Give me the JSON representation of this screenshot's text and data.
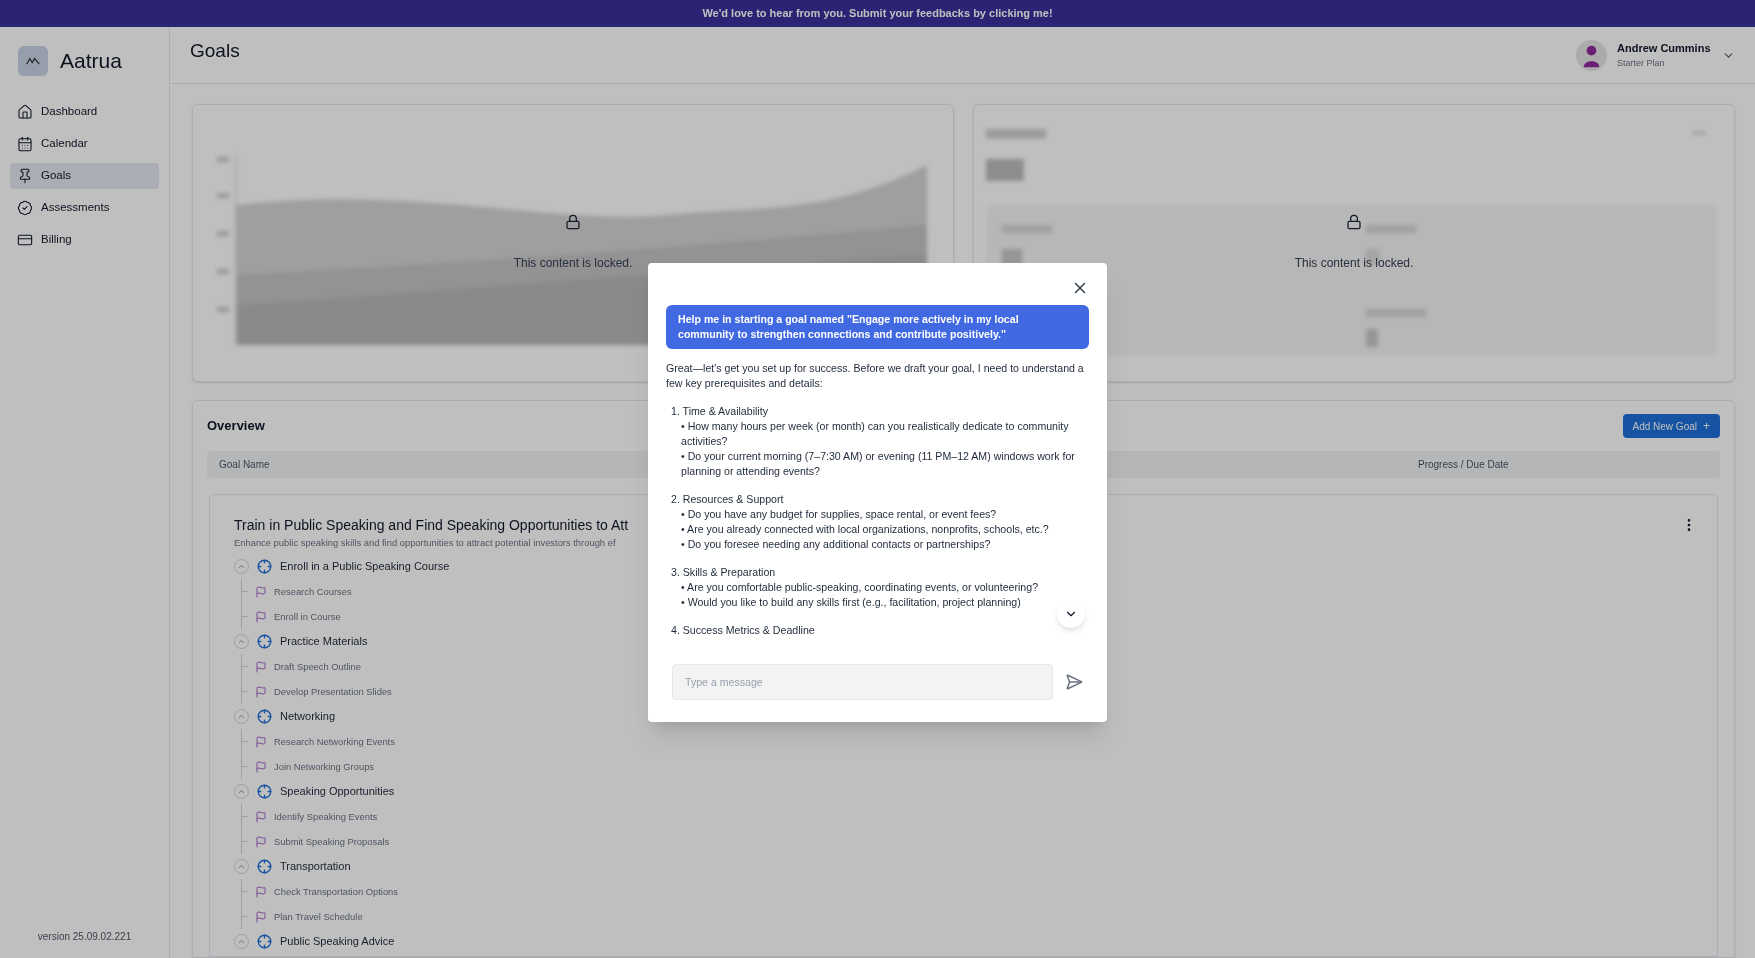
{
  "banner": {
    "text": "We'd love to hear from you. Submit your feedbacks by clicking me!"
  },
  "brand": {
    "name": "Aatrua"
  },
  "sidebar": {
    "items": [
      {
        "label": "Dashboard",
        "selected": false
      },
      {
        "label": "Calendar",
        "selected": false
      },
      {
        "label": "Goals",
        "selected": true
      },
      {
        "label": "Assessments",
        "selected": false
      },
      {
        "label": "Billing",
        "selected": false
      }
    ],
    "version": "version 25.09.02.221"
  },
  "header": {
    "title": "Goals",
    "user": {
      "name": "Andrew Cummins",
      "plan": "Starter Plan"
    }
  },
  "locked_panels": [
    {
      "kind": "chart",
      "lock_text": "This content is locked."
    },
    {
      "kind": "stats",
      "lock_text": "This content is locked."
    }
  ],
  "overview": {
    "title": "Overview",
    "add_button": "Add New Goal",
    "add_icon": "+",
    "columns": [
      "Goal Name",
      "Progress / Due Date"
    ],
    "goal": {
      "title": "Train in Public Speaking and Find Speaking Opportunities to Att",
      "description": "Enhance public speaking skills and find opportunities to attract potential investors through ef",
      "milestones": [
        {
          "title": "Enroll in a Public Speaking Course",
          "expanded": true,
          "children": [
            "Research Courses",
            "Enroll in Course"
          ]
        },
        {
          "title": "Practice Materials",
          "expanded": true,
          "children": [
            "Draft Speech Outline",
            "Develop Presentation Slides"
          ]
        },
        {
          "title": "Networking",
          "expanded": true,
          "children": [
            "Research Networking Events",
            "Join Networking Groups"
          ]
        },
        {
          "title": "Speaking Opportunities",
          "expanded": true,
          "children": [
            "Identify Speaking Events",
            "Submit Speaking Proposals"
          ]
        },
        {
          "title": "Transportation",
          "expanded": true,
          "children": [
            "Check Transportation Options",
            "Plan Travel Schedule"
          ]
        },
        {
          "title": "Public Speaking Advice",
          "expanded": true
        }
      ]
    }
  },
  "chat": {
    "user_message": "Help me in starting a goal named \"Engage more actively in my local community to strengthen connections and contribute positively.\"",
    "intro": "Great—let's get you set up for success. Before we draft your goal, I need to understand a few key prerequisites and details:",
    "sections": [
      {
        "title": "1. Time & Availability",
        "bullets": [
          "• How many hours per week (or month) can you realistically dedicate to community activities?",
          "• Do your current morning (7–7:30 AM) or evening (11 PM–12 AM) windows work for planning or attending events?"
        ]
      },
      {
        "title": "2. Resources & Support",
        "bullets": [
          "• Do you have any budget for supplies, space rental, or event fees?",
          "• Are you already connected with local organizations, nonprofits, schools, etc.?",
          "• Do you foresee needing any additional contacts or partnerships?"
        ]
      },
      {
        "title": "3. Skills & Preparation",
        "bullets": [
          "• Are you comfortable public-speaking, coordinating events, or volunteering?",
          "• Would you like to build any skills first (e.g., facilitation, project planning)"
        ]
      },
      {
        "title": "4. Success Metrics & Deadline"
      }
    ],
    "input": {
      "placeholder": "Type a message"
    }
  }
}
